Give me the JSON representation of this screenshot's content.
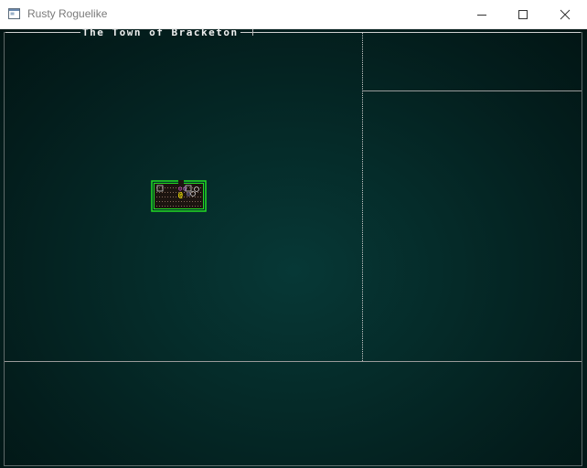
{
  "window": {
    "title": "Rusty Roguelike",
    "icons": {
      "app": "app-window-icon",
      "minimize": "minimize-icon",
      "maximize": "maximize-icon",
      "close": "close-icon"
    }
  },
  "game": {
    "map_name": "The Town of Bracketon",
    "colors": {
      "background": "#052a28",
      "frame": "#b8b8b8",
      "wall": "#22dd22",
      "floor": "#8a6a5a",
      "player": "#ffee00",
      "npc": "#ff66ff"
    },
    "glyphs": {
      "player": "@",
      "npc": "☺"
    }
  }
}
